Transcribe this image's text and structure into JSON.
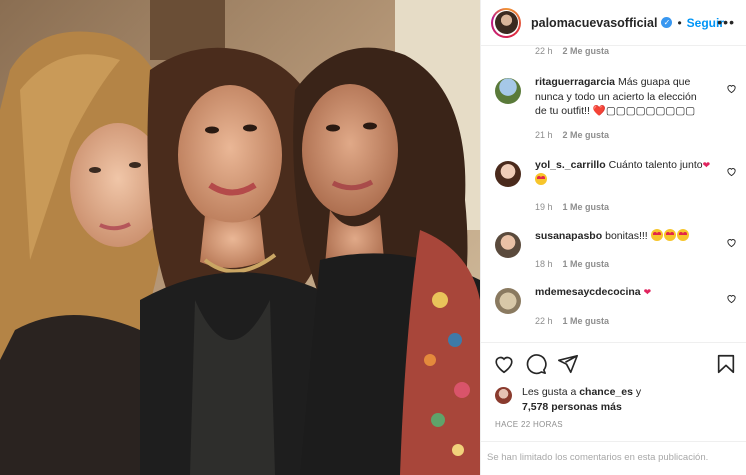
{
  "header": {
    "username": "palomacuevasofficial",
    "separator": "•",
    "follow_label": "Seguir",
    "more_label": "•••"
  },
  "first_comment_meta": {
    "time": "22 h",
    "likes": "2 Me gusta"
  },
  "comments": [
    {
      "user": "ritaguerragarcia",
      "text": "Más guapa que nunca y todo un acierto la elección de tu outfit!! ❤️",
      "extra": "▢▢▢▢▢▢▢▢▢",
      "time": "21 h",
      "likes": "2 Me gusta"
    },
    {
      "user": "yol_s._carrillo",
      "text": "Cuánto talento junto",
      "time": "19 h",
      "likes": "1 Me gusta"
    },
    {
      "user": "susanapasbo",
      "text": "bonitas!!!",
      "time": "18 h",
      "likes": "1 Me gusta"
    },
    {
      "user": "mdemesaycdecocina",
      "text": "",
      "time": "22 h",
      "likes": "1 Me gusta"
    }
  ],
  "likes": {
    "prefix": "Les gusta a",
    "user": "chance_es",
    "connector": "y",
    "count": "7,578 personas más"
  },
  "timestamp": "HACE 22 HORAS",
  "footer_text": "Se han limitado los comentarios en esta publicación.",
  "colors": {
    "accent": "#0095f6",
    "verified": "#3897f0",
    "meta": "#8e8e8e",
    "border": "#efefef"
  },
  "icons": [
    "verified-badge-icon",
    "heart-icon",
    "comment-icon",
    "share-icon",
    "bookmark-icon",
    "heart-eyes-emoji"
  ]
}
